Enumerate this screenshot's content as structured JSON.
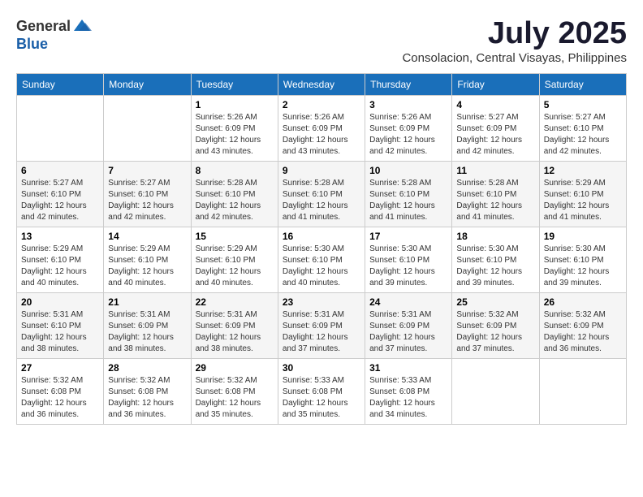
{
  "header": {
    "logo_general": "General",
    "logo_blue": "Blue",
    "month_title": "July 2025",
    "location": "Consolacion, Central Visayas, Philippines"
  },
  "calendar": {
    "days_of_week": [
      "Sunday",
      "Monday",
      "Tuesday",
      "Wednesday",
      "Thursday",
      "Friday",
      "Saturday"
    ],
    "weeks": [
      [
        {
          "day": "",
          "info": ""
        },
        {
          "day": "",
          "info": ""
        },
        {
          "day": "1",
          "info": "Sunrise: 5:26 AM\nSunset: 6:09 PM\nDaylight: 12 hours and 43 minutes."
        },
        {
          "day": "2",
          "info": "Sunrise: 5:26 AM\nSunset: 6:09 PM\nDaylight: 12 hours and 43 minutes."
        },
        {
          "day": "3",
          "info": "Sunrise: 5:26 AM\nSunset: 6:09 PM\nDaylight: 12 hours and 42 minutes."
        },
        {
          "day": "4",
          "info": "Sunrise: 5:27 AM\nSunset: 6:09 PM\nDaylight: 12 hours and 42 minutes."
        },
        {
          "day": "5",
          "info": "Sunrise: 5:27 AM\nSunset: 6:10 PM\nDaylight: 12 hours and 42 minutes."
        }
      ],
      [
        {
          "day": "6",
          "info": "Sunrise: 5:27 AM\nSunset: 6:10 PM\nDaylight: 12 hours and 42 minutes."
        },
        {
          "day": "7",
          "info": "Sunrise: 5:27 AM\nSunset: 6:10 PM\nDaylight: 12 hours and 42 minutes."
        },
        {
          "day": "8",
          "info": "Sunrise: 5:28 AM\nSunset: 6:10 PM\nDaylight: 12 hours and 42 minutes."
        },
        {
          "day": "9",
          "info": "Sunrise: 5:28 AM\nSunset: 6:10 PM\nDaylight: 12 hours and 41 minutes."
        },
        {
          "day": "10",
          "info": "Sunrise: 5:28 AM\nSunset: 6:10 PM\nDaylight: 12 hours and 41 minutes."
        },
        {
          "day": "11",
          "info": "Sunrise: 5:28 AM\nSunset: 6:10 PM\nDaylight: 12 hours and 41 minutes."
        },
        {
          "day": "12",
          "info": "Sunrise: 5:29 AM\nSunset: 6:10 PM\nDaylight: 12 hours and 41 minutes."
        }
      ],
      [
        {
          "day": "13",
          "info": "Sunrise: 5:29 AM\nSunset: 6:10 PM\nDaylight: 12 hours and 40 minutes."
        },
        {
          "day": "14",
          "info": "Sunrise: 5:29 AM\nSunset: 6:10 PM\nDaylight: 12 hours and 40 minutes."
        },
        {
          "day": "15",
          "info": "Sunrise: 5:29 AM\nSunset: 6:10 PM\nDaylight: 12 hours and 40 minutes."
        },
        {
          "day": "16",
          "info": "Sunrise: 5:30 AM\nSunset: 6:10 PM\nDaylight: 12 hours and 40 minutes."
        },
        {
          "day": "17",
          "info": "Sunrise: 5:30 AM\nSunset: 6:10 PM\nDaylight: 12 hours and 39 minutes."
        },
        {
          "day": "18",
          "info": "Sunrise: 5:30 AM\nSunset: 6:10 PM\nDaylight: 12 hours and 39 minutes."
        },
        {
          "day": "19",
          "info": "Sunrise: 5:30 AM\nSunset: 6:10 PM\nDaylight: 12 hours and 39 minutes."
        }
      ],
      [
        {
          "day": "20",
          "info": "Sunrise: 5:31 AM\nSunset: 6:10 PM\nDaylight: 12 hours and 38 minutes."
        },
        {
          "day": "21",
          "info": "Sunrise: 5:31 AM\nSunset: 6:09 PM\nDaylight: 12 hours and 38 minutes."
        },
        {
          "day": "22",
          "info": "Sunrise: 5:31 AM\nSunset: 6:09 PM\nDaylight: 12 hours and 38 minutes."
        },
        {
          "day": "23",
          "info": "Sunrise: 5:31 AM\nSunset: 6:09 PM\nDaylight: 12 hours and 37 minutes."
        },
        {
          "day": "24",
          "info": "Sunrise: 5:31 AM\nSunset: 6:09 PM\nDaylight: 12 hours and 37 minutes."
        },
        {
          "day": "25",
          "info": "Sunrise: 5:32 AM\nSunset: 6:09 PM\nDaylight: 12 hours and 37 minutes."
        },
        {
          "day": "26",
          "info": "Sunrise: 5:32 AM\nSunset: 6:09 PM\nDaylight: 12 hours and 36 minutes."
        }
      ],
      [
        {
          "day": "27",
          "info": "Sunrise: 5:32 AM\nSunset: 6:08 PM\nDaylight: 12 hours and 36 minutes."
        },
        {
          "day": "28",
          "info": "Sunrise: 5:32 AM\nSunset: 6:08 PM\nDaylight: 12 hours and 36 minutes."
        },
        {
          "day": "29",
          "info": "Sunrise: 5:32 AM\nSunset: 6:08 PM\nDaylight: 12 hours and 35 minutes."
        },
        {
          "day": "30",
          "info": "Sunrise: 5:33 AM\nSunset: 6:08 PM\nDaylight: 12 hours and 35 minutes."
        },
        {
          "day": "31",
          "info": "Sunrise: 5:33 AM\nSunset: 6:08 PM\nDaylight: 12 hours and 34 minutes."
        },
        {
          "day": "",
          "info": ""
        },
        {
          "day": "",
          "info": ""
        }
      ]
    ]
  }
}
